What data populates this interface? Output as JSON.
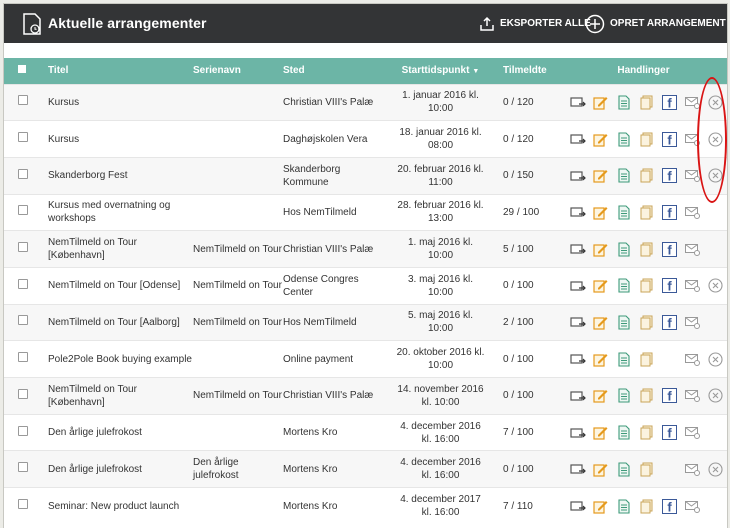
{
  "header": {
    "title": "Aktuelle arrangementer",
    "export_label": "EKSPORTER ALLE",
    "create_label": "OPRET ARRANGEMENT"
  },
  "columns": {
    "title": "Titel",
    "series": "Serienavn",
    "place": "Sted",
    "start": "Starttidspunkt",
    "registered": "Tilmeldte",
    "actions": "Handlinger"
  },
  "rows": [
    {
      "title": "Kursus",
      "series": "",
      "place": "Christian VIII's Palæ",
      "start": "1. januar 2016 kl. 10:00",
      "registered": "0 / 120",
      "cancel": true
    },
    {
      "title": "Kursus",
      "series": "",
      "place": "Daghøjskolen Vera",
      "start": "18. januar 2016 kl. 08:00",
      "registered": "0 / 120",
      "cancel": true
    },
    {
      "title": "Skanderborg Fest",
      "series": "",
      "place": "Skanderborg Kommune",
      "start": "20. februar 2016 kl. 11:00",
      "registered": "0 / 150",
      "cancel": true
    },
    {
      "title": "Kursus med overnatning og workshops",
      "series": "",
      "place": "Hos NemTilmeld",
      "start": "28. februar 2016 kl. 13:00",
      "registered": "29 / 100",
      "cancel": false
    },
    {
      "title": "NemTilmeld on Tour [København]",
      "series": "NemTilmeld on Tour",
      "place": "Christian VIII's Palæ",
      "start": "1. maj 2016 kl. 10:00",
      "registered": "5 / 100",
      "cancel": false
    },
    {
      "title": "NemTilmeld on Tour [Odense]",
      "series": "NemTilmeld on Tour",
      "place": "Odense Congres Center",
      "start": "3. maj 2016 kl. 10:00",
      "registered": "0 / 100",
      "cancel": true
    },
    {
      "title": "NemTilmeld on Tour [Aalborg]",
      "series": "NemTilmeld on Tour",
      "place": "Hos NemTilmeld",
      "start": "5. maj 2016 kl. 10:00",
      "registered": "2 / 100",
      "cancel": false
    },
    {
      "title": "Pole2Pole Book buying example",
      "series": "",
      "place": "Online payment",
      "start": "20. oktober 2016 kl. 10:00",
      "registered": "0 / 100",
      "cancel": true,
      "no_facebook": true
    },
    {
      "title": "NemTilmeld on Tour [København]",
      "series": "NemTilmeld on Tour",
      "place": "Christian VIII's Palæ",
      "start": "14. november 2016 kl. 10:00",
      "registered": "0 / 100",
      "cancel": true
    },
    {
      "title": "Den årlige julefrokost",
      "series": "",
      "place": "Mortens Kro",
      "start": "4. december 2016 kl. 16:00",
      "registered": "7 / 100",
      "cancel": false
    },
    {
      "title": "Den årlige julefrokost",
      "series": "Den årlige julefrokost",
      "place": "Mortens Kro",
      "start": "4. december 2016 kl. 16:00",
      "registered": "0 / 100",
      "cancel": true,
      "no_facebook": true
    },
    {
      "title": "Seminar: New product launch",
      "series": "",
      "place": "Mortens Kro",
      "start": "4. december 2017 kl. 16:00",
      "registered": "7 / 110",
      "cancel": false
    }
  ],
  "icons": [
    "move-event-icon",
    "edit-icon",
    "document-icon",
    "copy-icon",
    "facebook-icon",
    "email-icon",
    "cancel-icon"
  ],
  "colors": {
    "topbar": "#333436",
    "header_row": "#6cb5a6",
    "edit": "#e59a1d",
    "document": "#3d9a7a",
    "facebook": "#3b5998",
    "annotation": "#d91414"
  }
}
